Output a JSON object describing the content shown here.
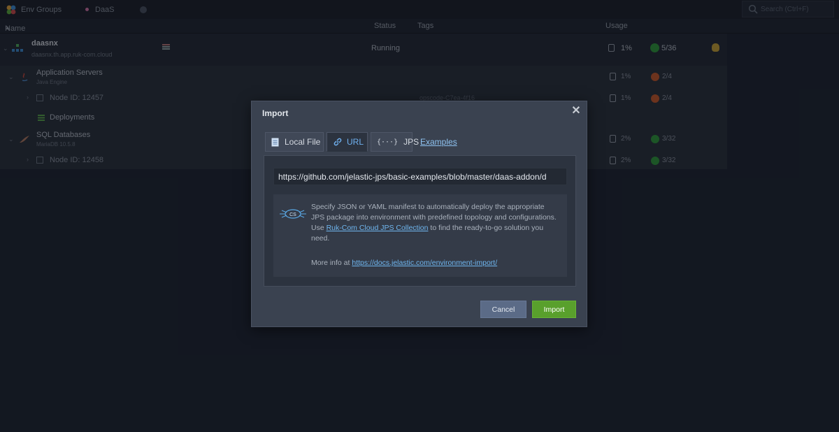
{
  "topbar": {
    "env_groups": "Env Groups",
    "daas_tab": "DaaS",
    "search_placeholder": "Search (Ctrl+F)"
  },
  "columns": {
    "name": "Name",
    "sort_indicator": "▲",
    "status": "Status",
    "tags": "Tags",
    "usage": "Usage"
  },
  "environment": {
    "name": "daasnx",
    "domain": "daasnx.th.app.ruk-com.cloud",
    "status": "Running",
    "disk": "1%",
    "cloudlets": "5/36"
  },
  "groups": [
    {
      "label": "Application Servers",
      "engine": "Java Engine",
      "disk": "1%",
      "cloudlets": "2/4",
      "node": {
        "label": "Node ID: 12457",
        "tag": "opscode-C7ea-4f16",
        "disk": "1%",
        "cloudlets": "2/4"
      },
      "deployments": "Deployments"
    },
    {
      "label": "SQL Databases",
      "engine": "MariaDB 10.5.8",
      "disk": "2%",
      "cloudlets": "3/32",
      "node": {
        "label": "Node ID: 12458",
        "disk": "2%",
        "cloudlets": "3/32"
      }
    }
  ],
  "dialog": {
    "title": "Import",
    "tabs": {
      "local_file": "Local File",
      "url": "URL",
      "jps": "JPS",
      "examples": "Examples"
    },
    "url_value": "https://github.com/jelastic-jps/basic-examples/blob/master/daas-addon/d",
    "info": {
      "line1": "Specify JSON or YAML manifest to automatically deploy the appropriate JPS package into environment with predefined topology and configurations.",
      "use_prefix": "Use ",
      "collection_link": "Ruk-Com Cloud JPS Collection",
      "use_suffix": " to find the ready-to-go solution you need.",
      "more_prefix": "More info at ",
      "docs_link": "https://docs.jelastic.com/environment-import/"
    },
    "logo_text": "CS",
    "cancel": "Cancel",
    "import": "Import"
  },
  "colors": {
    "accent_blue": "#6fb0ef",
    "import_green": "#59a02c",
    "cancel_blue": "#5b6b87",
    "gear_green": "#2e9a3a",
    "gear_orange": "#c8582a"
  },
  "icons": [
    "env-groups-icon",
    "search-icon",
    "disk-icon",
    "cloudlet-icon",
    "billing-icon",
    "url-link-icon",
    "file-icon",
    "jps-icon",
    "close-icon"
  ]
}
